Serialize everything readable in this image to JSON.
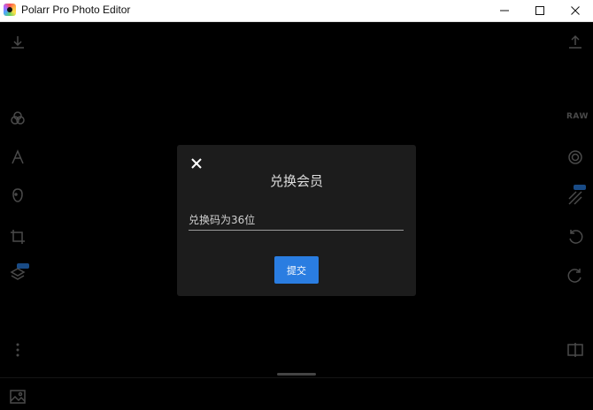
{
  "window": {
    "title": "Polarr Pro Photo Editor",
    "icons": [
      "app-icon",
      "minimize-icon",
      "maximize-icon",
      "close-icon"
    ]
  },
  "left_toolbar": {
    "icons": [
      "download-icon",
      "filters-icon",
      "text-icon",
      "face-icon",
      "crop-icon",
      "layers-icon",
      "more-icon",
      "gallery-icon"
    ]
  },
  "right_toolbar": {
    "raw_label": "RAW",
    "icons": [
      "upload-icon",
      "lens-icon",
      "mask-icon",
      "undo-icon",
      "redo-icon",
      "compare-icon"
    ]
  },
  "colors": {
    "accent": "#2a7de1",
    "dialog_bg": "#1c1c1c",
    "canvas_bg": "#000000",
    "badge": "#1f5ea8"
  },
  "dialog": {
    "title": "兑换会员",
    "input_placeholder": "兑换码为36位",
    "submit_label": "提交"
  }
}
